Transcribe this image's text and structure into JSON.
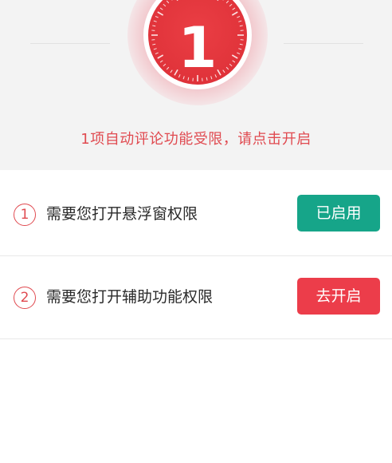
{
  "header": {
    "counter_value": "1",
    "notice": "1项自动评论功能受限，请点击开启"
  },
  "permissions": [
    {
      "step": "1",
      "label": "需要您打开悬浮窗权限",
      "button_label": "已启用",
      "button_color": "#16a589"
    },
    {
      "step": "2",
      "label": "需要您打开辅助功能权限",
      "button_label": "去开启",
      "button_color": "#ec3d4a"
    }
  ],
  "colors": {
    "accent_red": "#e0333a",
    "notice_text": "#e04a50",
    "header_bg": "#f3f3f3"
  }
}
